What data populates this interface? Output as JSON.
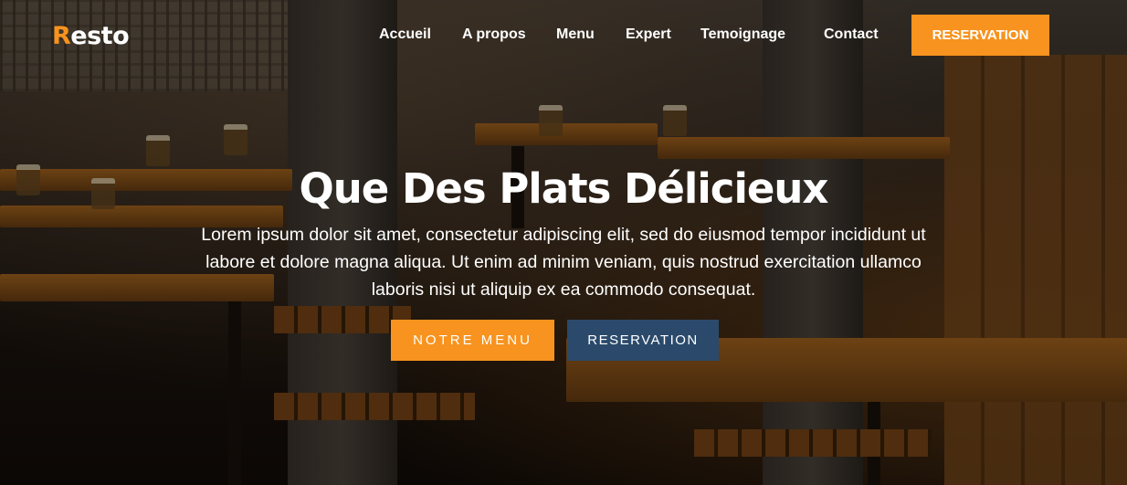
{
  "brand": {
    "first_letter": "R",
    "rest": "esto",
    "accent_color": "#f7931e"
  },
  "nav": {
    "items": [
      {
        "label": "Accueil"
      },
      {
        "label": "A propos"
      },
      {
        "label": "Menu"
      },
      {
        "label": "Expert"
      },
      {
        "label": "Temoignage"
      },
      {
        "label": "Contact"
      }
    ],
    "cta_label": "RESERVATION"
  },
  "hero": {
    "title": "Que Des Plats Délicieux",
    "text": "Lorem ipsum dolor sit amet, consectetur adipiscing elit, sed do eiusmod tempor incididunt ut labore et dolore magna aliqua. Ut enim ad minim veniam, quis nostrud exercitation ullamco laboris nisi ut aliquip ex ea commodo consequat.",
    "primary_button": "NOTRE MENU",
    "secondary_button": "RESERVATION"
  },
  "colors": {
    "accent": "#f7931e",
    "secondary": "#2b4a6b"
  }
}
